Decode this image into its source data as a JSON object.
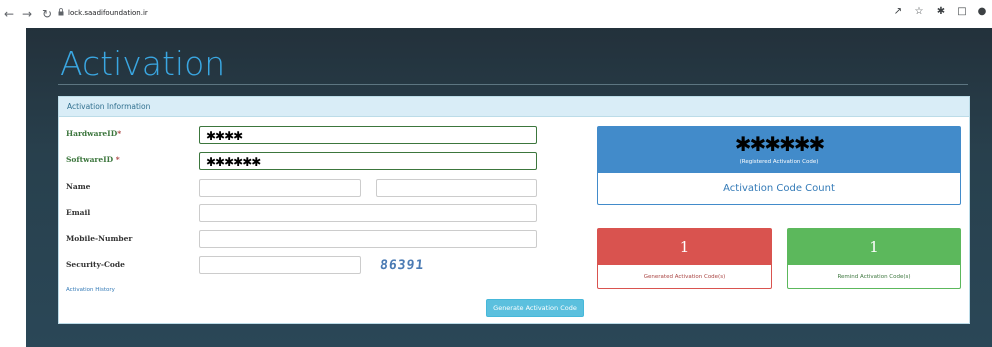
{
  "browser": {
    "url": "lock.saadifoundation.ir",
    "back_icon": "arrow-left-icon",
    "forward_icon": "arrow-right-icon",
    "reload_icon": "reload-icon"
  },
  "logo": {
    "text": "Activation",
    "color": "#3aa7e2"
  },
  "panel": {
    "heading": "Activation Information"
  },
  "form": {
    "hardware_label": "HardwareID",
    "hardware_required": "*",
    "hardware_value": "✱✱✱✱",
    "software_label": "SoftwareID",
    "software_required": "*",
    "software_value": "✱✱✱✱✱✱",
    "name_label": "Name",
    "name_first_value": "",
    "name_last_value": "",
    "email_label": "Email",
    "email_value": "",
    "mobile_label": "Mobile-Number",
    "mobile_value": "",
    "security_label": "Security-Code",
    "security_value": "",
    "captcha_text": "86391",
    "history_link": "Activation History",
    "generate_button": "Generate Activation Code"
  },
  "registered": {
    "code": "✱✱✱✱✱✱",
    "caption": "(Registered Activation Code)",
    "count_label": "Activation Code Count"
  },
  "generated": {
    "value": "1",
    "caption": "Generated Activation Code(s)"
  },
  "remind": {
    "value": "1",
    "caption": "Remind Activation Code(s)"
  },
  "colors": {
    "primary": "#428bca",
    "danger": "#d9534f",
    "success": "#5cb85c",
    "info": "#5bc0de",
    "panel_head": "#d9edf7"
  }
}
